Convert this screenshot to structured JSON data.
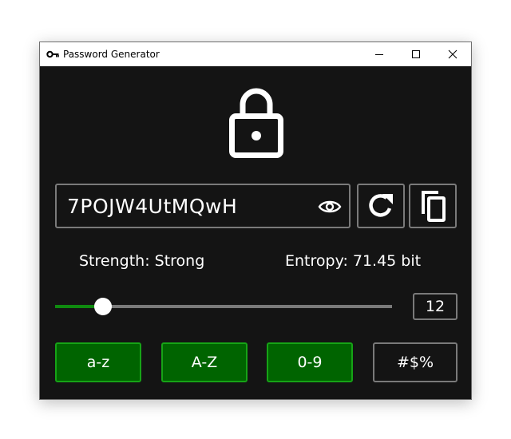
{
  "window": {
    "title": "Password Generator",
    "app_icon": "key-icon",
    "controls": [
      "minimize-icon",
      "maximize-icon",
      "close-icon"
    ]
  },
  "header_icon": "lock-icon",
  "password": {
    "value": "7POJW4UtMQwH",
    "reveal_icon": "eye-icon"
  },
  "actions": {
    "refresh_icon": "refresh-icon",
    "copy_icon": "copy-icon"
  },
  "stats": {
    "strength_text": "Strength: Strong",
    "entropy_text": "Entropy: 71.45 bit"
  },
  "length": {
    "value": "12",
    "slider_fraction": 0.14
  },
  "char_sets": [
    {
      "label": "a-z",
      "enabled": true
    },
    {
      "label": "A-Z",
      "enabled": true
    },
    {
      "label": "0-9",
      "enabled": true
    },
    {
      "label": "#$%",
      "enabled": false
    }
  ],
  "colors": {
    "background": "#141414",
    "accent_green": "#006400",
    "accent_border": "#16a316",
    "slider_fill": "#0f8a0f"
  }
}
